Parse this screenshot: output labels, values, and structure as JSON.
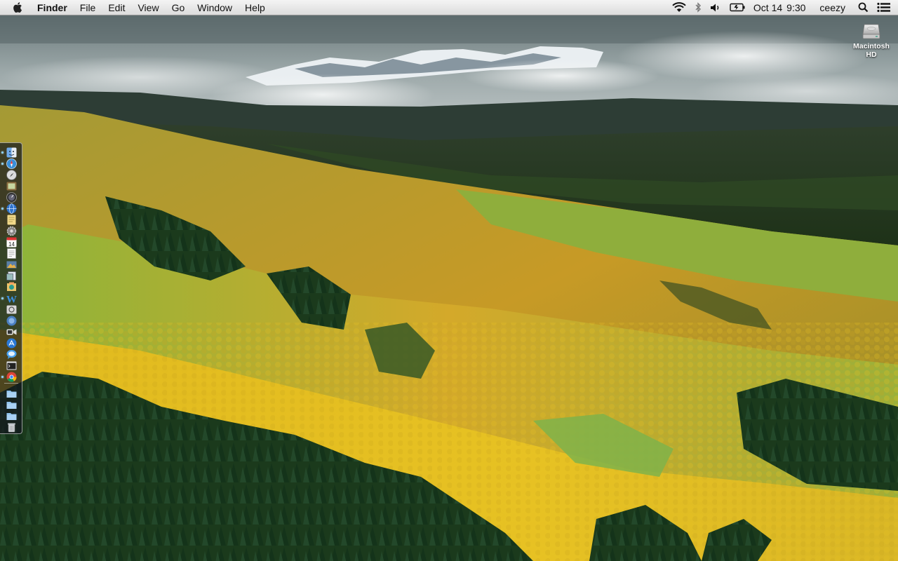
{
  "menubar": {
    "app_name": "Finder",
    "menus": [
      "File",
      "Edit",
      "View",
      "Go",
      "Window",
      "Help"
    ],
    "date": "Oct 14",
    "time": "9:30",
    "user": "ceezy",
    "status_icons": [
      "wifi-icon",
      "bluetooth-icon",
      "volume-icon",
      "battery-icon",
      "spotlight-icon",
      "notification-center-icon"
    ]
  },
  "desktop": {
    "drive_label_line1": "Macintosh",
    "drive_label_line2": "HD"
  },
  "dock": {
    "position": "left",
    "apps": [
      {
        "icon": "finder-icon",
        "running": true
      },
      {
        "icon": "safari-icon",
        "running": true
      },
      {
        "icon": "compass-icon",
        "running": false
      },
      {
        "icon": "photo-booth-icon",
        "running": false
      },
      {
        "icon": "dashboard-icon",
        "running": false
      },
      {
        "icon": "globe-icon",
        "running": true
      },
      {
        "icon": "notes-icon",
        "running": false
      },
      {
        "icon": "system-preferences-icon",
        "running": false
      },
      {
        "icon": "calendar-icon",
        "running": false
      },
      {
        "icon": "textedit-icon",
        "running": false
      },
      {
        "icon": "image-capture-icon",
        "running": false
      },
      {
        "icon": "preview-icon",
        "running": false
      },
      {
        "icon": "photos-icon",
        "running": false
      },
      {
        "icon": "word-icon",
        "running": true
      },
      {
        "icon": "screen-sharing-icon",
        "running": false
      },
      {
        "icon": "network-icon",
        "running": false
      },
      {
        "icon": "facetime-icon",
        "running": false
      },
      {
        "icon": "app-store-icon",
        "running": false
      },
      {
        "icon": "messages-icon",
        "running": false
      },
      {
        "icon": "terminal-icon",
        "running": false
      },
      {
        "icon": "chrome-icon",
        "running": true
      }
    ],
    "stacks": [
      "applications-folder-icon",
      "documents-folder-icon",
      "downloads-folder-icon",
      "trash-icon"
    ]
  },
  "colors": {
    "accent": "#3a8fd8",
    "running_indicator": "#8fd3ff"
  }
}
